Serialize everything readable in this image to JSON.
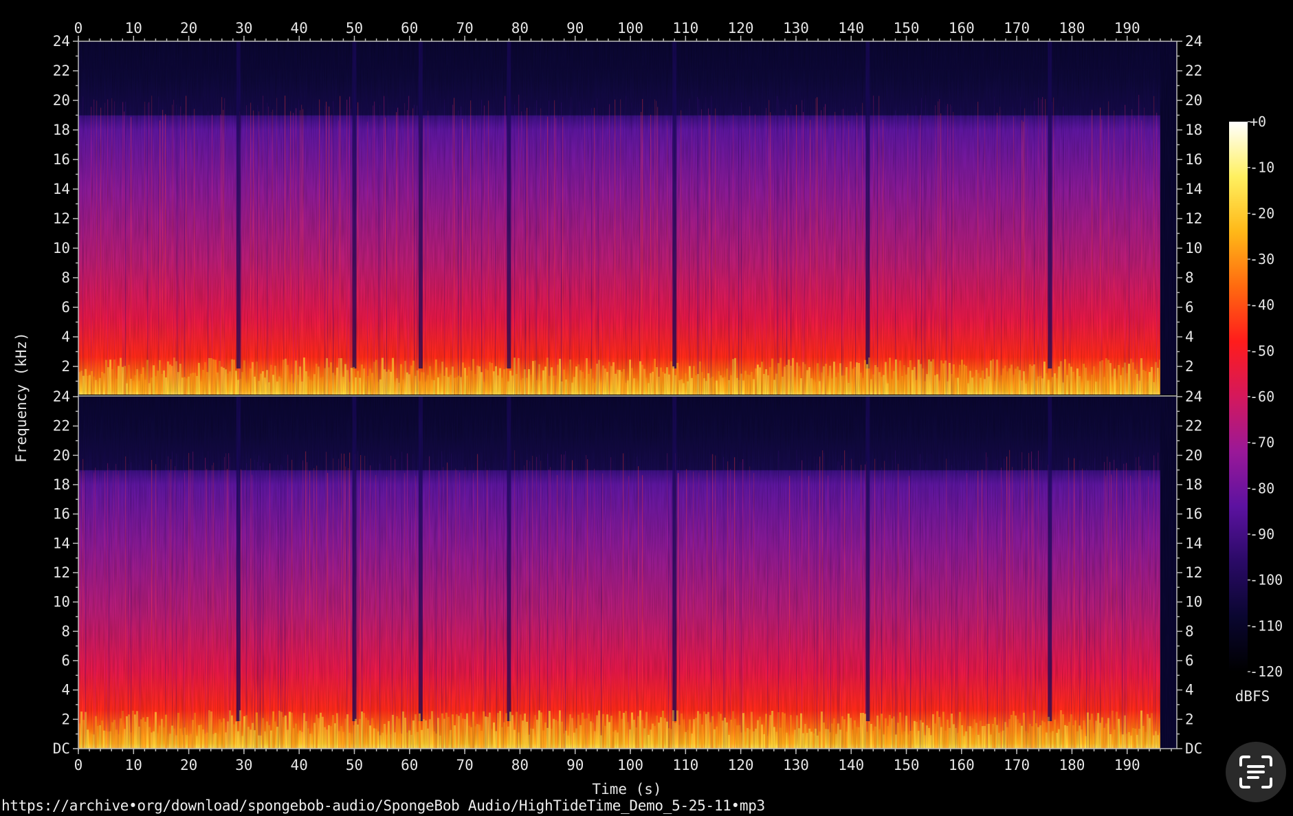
{
  "chart_data": {
    "type": "heatmap",
    "subtype": "spectrogram",
    "channels": 2,
    "xlabel": "Time (s)",
    "ylabel": "Frequency (kHz)",
    "xlim": [
      0,
      199
    ],
    "ylim": [
      0,
      24
    ],
    "x_ticks": [
      "0",
      "10",
      "20",
      "30",
      "40",
      "50",
      "60",
      "70",
      "80",
      "90",
      "100",
      "110",
      "120",
      "130",
      "140",
      "150",
      "160",
      "170",
      "180",
      "190"
    ],
    "y_ticks": [
      "DC",
      "2",
      "4",
      "6",
      "8",
      "10",
      "12",
      "14",
      "16",
      "18",
      "20",
      "22",
      "24"
    ],
    "colorbar": {
      "label": "dBFS",
      "range": [
        -120,
        0
      ],
      "ticks": [
        "+0",
        "-10",
        "-20",
        "-30",
        "-40",
        "-50",
        "-60",
        "-70",
        "-80",
        "-90",
        "-100",
        "-110",
        "-120"
      ],
      "colormap": [
        "#000000",
        "#0a0630",
        "#2a0a66",
        "#5c12a0",
        "#9a1898",
        "#d4185c",
        "#ff1c1c",
        "#ff6a10",
        "#ffb818",
        "#fff060",
        "#ffffff"
      ]
    },
    "content_cutoff_khz": 19,
    "audio_end_s": 196,
    "quiet_gaps_s": [
      29,
      50,
      62,
      78,
      108,
      143,
      176
    ]
  },
  "footer": {
    "source_url": "https://archive•org/download/spongebob-audio/SpongeBob Audio/HighTideTime_Demo_5-25-11•mp3"
  },
  "icons": {
    "lens": "text-scan-icon"
  }
}
